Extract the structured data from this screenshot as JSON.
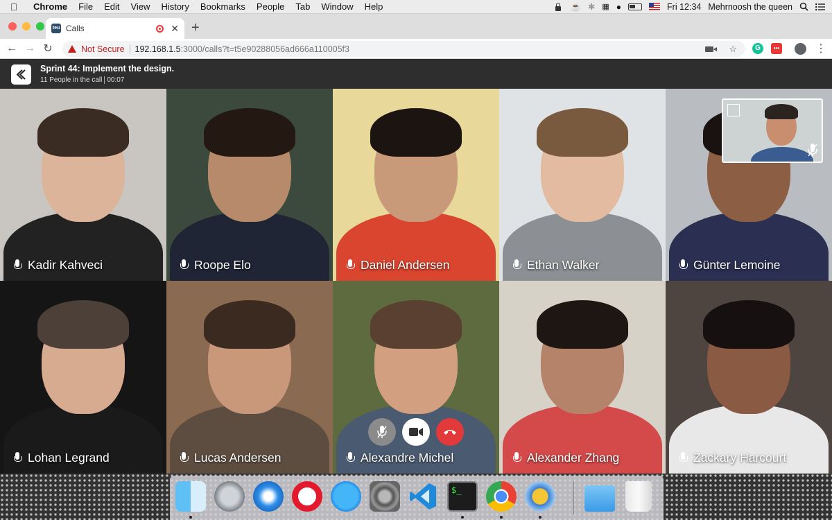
{
  "menubar": {
    "app": "Chrome",
    "items": [
      "File",
      "Edit",
      "View",
      "History",
      "Bookmarks",
      "People",
      "Tab",
      "Window",
      "Help"
    ],
    "clock": "Fri 12:34",
    "user": "Mehrnoosh the queen"
  },
  "browser": {
    "tab_title": "Calls",
    "favicon_text": "teu",
    "security_label": "Not Secure",
    "url_host": "192.168.1.5",
    "url_rest": ":3000/calls?t=t5e90288056ad666a110005f3"
  },
  "call": {
    "title": "Sprint 44: Implement the design.",
    "people_count": "11 People in the call",
    "duration": "00:07"
  },
  "participants": [
    {
      "name": "Kadir Kahveci"
    },
    {
      "name": "Roope Elo"
    },
    {
      "name": "Daniel Andersen"
    },
    {
      "name": "Ethan Walker"
    },
    {
      "name": "Günter Lemoine"
    },
    {
      "name": "Lohan Legrand"
    },
    {
      "name": "Lucas Andersen"
    },
    {
      "name": "Alexandre Michel"
    },
    {
      "name": "Alexander Zhang"
    },
    {
      "name": "Zackary Harcourt"
    }
  ],
  "tile_colors": [
    {
      "bg": "#c9c6c1",
      "skin": "#dcb49a",
      "hair": "#3a2c22",
      "cloth": "#222222"
    },
    {
      "bg": "#3b4a3c",
      "skin": "#b88a6c",
      "hair": "#241812",
      "cloth": "#1f2535"
    },
    {
      "bg": "#e8d89a",
      "skin": "#c89a7a",
      "hair": "#1c1410",
      "cloth": "#d9452f"
    },
    {
      "bg": "#dfe3e6",
      "skin": "#e3bba0",
      "hair": "#7a5a3e",
      "cloth": "#8c8f93"
    },
    {
      "bg": "#b9bcc0",
      "skin": "#8c5e44",
      "hair": "#1a1210",
      "cloth": "#2b2f52"
    },
    {
      "bg": "#151515",
      "skin": "#d7ab90",
      "hair": "#4c4038",
      "cloth": "#1a1a1a"
    },
    {
      "bg": "#8a6b52",
      "skin": "#c9977a",
      "hair": "#3a2a20",
      "cloth": "#5d4d40"
    },
    {
      "bg": "#5e6b3e",
      "skin": "#d2a080",
      "hair": "#5a4030",
      "cloth": "#4a5a70"
    },
    {
      "bg": "#d6d2c8",
      "skin": "#b5836a",
      "hair": "#1e1612",
      "cloth": "#d44a4a"
    },
    {
      "bg": "#4e4540",
      "skin": "#8a5a42",
      "hair": "#171010",
      "cloth": "#e8e8e8"
    }
  ],
  "colors": {
    "header_bg": "#2e2e2e",
    "hangup": "#e23a3a",
    "warning": "#c5221f"
  }
}
